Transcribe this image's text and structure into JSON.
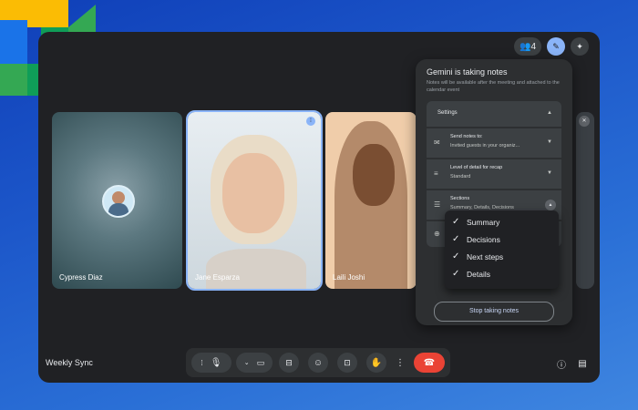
{
  "topbar": {
    "participants_count": "4"
  },
  "tiles": [
    {
      "name": "Cypress Diaz"
    },
    {
      "name": "Jane Esparza"
    },
    {
      "name": "Laili Joshi"
    }
  ],
  "gemini_panel": {
    "title": "Gemini is taking notes",
    "subtitle": "Notes will be available after the meeting and attached to the calendar event",
    "settings_label": "Settings",
    "send_notes_label": "Send notes to:",
    "send_notes_value": "Invited guests in your organiz...",
    "detail_label": "Level of detail for recap",
    "detail_value": "Standard",
    "sections_label": "Sections",
    "sections_value": "Summary, Details, Decisions",
    "dropdown_items": [
      "Summary",
      "Decisions",
      "Next steps",
      "Details"
    ],
    "stop_button": "Stop taking notes"
  },
  "bottom": {
    "meeting_name": "Weekly Sync"
  },
  "icons": {
    "check": "check-icon",
    "mic": "mic-icon",
    "camera": "camera-icon",
    "captions": "captions-icon",
    "emoji": "emoji-icon",
    "present": "present-icon",
    "raise_hand": "raise-hand-icon",
    "more": "more-vert-icon",
    "end_call": "end-call-icon",
    "info": "info-icon",
    "chat": "chat-icon"
  },
  "colors": {
    "end_call": "#ea4335",
    "accent": "#8ab4f8",
    "window_bg": "#202124"
  }
}
